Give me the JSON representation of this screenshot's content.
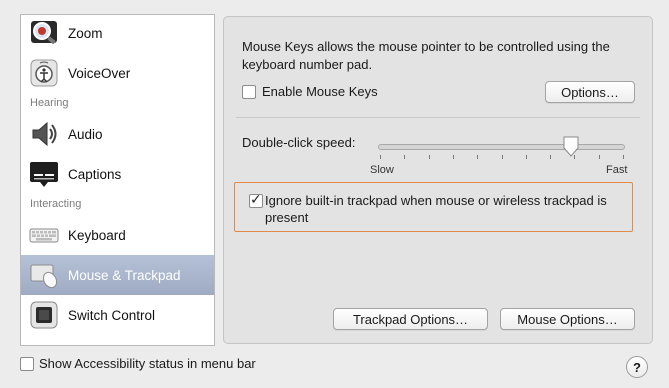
{
  "sidebar": {
    "items": [
      {
        "label": "Zoom",
        "icon": "zoom-icon"
      },
      {
        "label": "VoiceOver",
        "icon": "voiceover-icon"
      },
      {
        "label": "Audio",
        "icon": "speaker-icon"
      },
      {
        "label": "Captions",
        "icon": "captions-icon"
      },
      {
        "label": "Keyboard",
        "icon": "keyboard-icon"
      },
      {
        "label": "Mouse & Trackpad",
        "icon": "mouse-trackpad-icon"
      },
      {
        "label": "Switch Control",
        "icon": "switch-control-icon"
      }
    ],
    "headers": [
      "Hearing",
      "Interacting"
    ],
    "selected": "Mouse & Trackpad"
  },
  "panel": {
    "description": "Mouse Keys allows the mouse pointer to be controlled using the keyboard number pad.",
    "enable_mouse_keys_label": "Enable Mouse Keys",
    "enable_mouse_keys_checked": false,
    "options_button": "Options…",
    "double_click_label": "Double-click speed:",
    "slider_min_label": "Slow",
    "slider_max_label": "Fast",
    "slider_value_fraction": 0.78,
    "ignore_trackpad_label": "Ignore built-in trackpad when mouse or wireless trackpad is present",
    "ignore_trackpad_checked": true,
    "trackpad_options_button": "Trackpad Options…",
    "mouse_options_button": "Mouse Options…"
  },
  "footer": {
    "show_status_label": "Show Accessibility status in menu bar",
    "show_status_checked": false,
    "help_label": "?"
  },
  "colors": {
    "selection": "#9eabc3",
    "highlight_border": "#e28a4a"
  }
}
